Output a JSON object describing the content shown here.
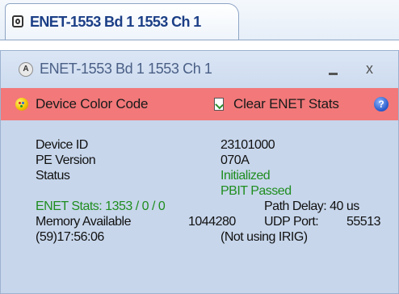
{
  "tab": {
    "title": "ENET-1553 Bd 1 1553 Ch 1"
  },
  "window": {
    "title": "ENET-1553 Bd 1 1553 Ch 1",
    "close_label": "x"
  },
  "toolbar": {
    "device_color_code": "Device Color Code",
    "clear_enet_stats": "Clear ENET Stats",
    "help_label": "?",
    "background": "#f27879"
  },
  "device": {
    "id_label": "Device ID",
    "id_value": "23101000",
    "pe_label": "PE Version",
    "pe_value": "070A",
    "status_label": "Status",
    "status_value_1": "Initialized",
    "status_value_2": "PBIT Passed",
    "enet_stats": "ENET Stats: 1353 / 0 / 0",
    "path_delay": "Path Delay: 40 us",
    "memory_label": "Memory Available",
    "memory_value": "1044280",
    "udp_label": "UDP Port:",
    "udp_value": "55513",
    "time": "(59)17:56:06",
    "irig": "(Not using IRIG)"
  },
  "colors": {
    "status_green": "#1f8d1f",
    "window_bg": "#c7d6eb",
    "tab_title": "#1b3e86"
  }
}
